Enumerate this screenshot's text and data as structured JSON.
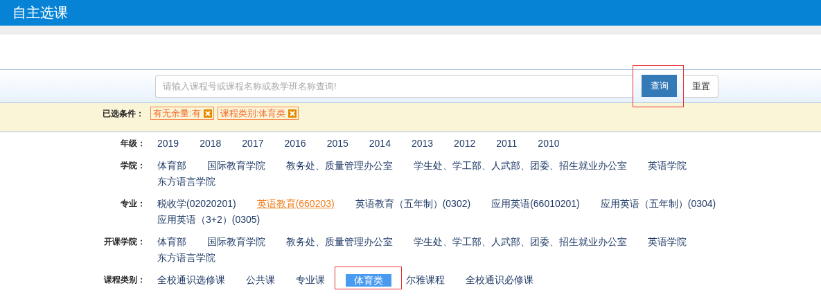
{
  "header": {
    "title": "自主选课"
  },
  "search": {
    "placeholder": "请输入课程号或课程名称或教学班名称查询!",
    "buttons": [
      {
        "label": "查询",
        "kind": "primary",
        "highlighted": true
      },
      {
        "label": "重置",
        "kind": "plain",
        "highlighted": false
      }
    ]
  },
  "selected_conditions": {
    "label": "已选条件：",
    "chips": [
      {
        "label": "有无余量:有"
      },
      {
        "label": "课程类别:体育类"
      }
    ]
  },
  "filters": [
    {
      "label": "年级：",
      "kind": "text",
      "options": [
        {
          "label": "2019",
          "selected": false
        },
        {
          "label": "2018",
          "selected": false
        },
        {
          "label": "2017",
          "selected": false
        },
        {
          "label": "2016",
          "selected": false
        },
        {
          "label": "2015",
          "selected": false
        },
        {
          "label": "2014",
          "selected": false
        },
        {
          "label": "2013",
          "selected": false
        },
        {
          "label": "2012",
          "selected": false
        },
        {
          "label": "2011",
          "selected": false
        },
        {
          "label": "2010",
          "selected": false
        }
      ]
    },
    {
      "label": "学院：",
      "kind": "text",
      "options": [
        {
          "label": "体育部",
          "selected": false
        },
        {
          "label": "国际教育学院",
          "selected": false
        },
        {
          "label": "教务处、质量管理办公室",
          "selected": false
        },
        {
          "label": "学生处、学工部、人武部、团委、招生就业办公室",
          "selected": false
        },
        {
          "label": "英语学院",
          "selected": false
        },
        {
          "label": "东方语言学院",
          "selected": false
        }
      ]
    },
    {
      "label": "专业：",
      "kind": "text",
      "options": [
        {
          "label": "税收学(02020201)",
          "selected": false
        },
        {
          "label": "英语教育(660203)",
          "selected": true
        },
        {
          "label": "英语教育（五年制）(0302)",
          "selected": false
        },
        {
          "label": "应用英语(66010201)",
          "selected": false
        },
        {
          "label": "应用英语（五年制）(0304)",
          "selected": false
        },
        {
          "label": "应用英语（3+2）(0305)",
          "selected": false
        }
      ]
    },
    {
      "label": "开课学院：",
      "kind": "text",
      "options": [
        {
          "label": "体育部",
          "selected": false
        },
        {
          "label": "国际教育学院",
          "selected": false
        },
        {
          "label": "教务处、质量管理办公室",
          "selected": false
        },
        {
          "label": "学生处、学工部、人武部、团委、招生就业办公室",
          "selected": false
        },
        {
          "label": "英语学院",
          "selected": false
        },
        {
          "label": "东方语言学院",
          "selected": false
        }
      ]
    },
    {
      "label": "课程类别：",
      "kind": "pill",
      "options": [
        {
          "label": "全校通识选修课",
          "selected": false,
          "highlighted": false
        },
        {
          "label": "公共课",
          "selected": false,
          "highlighted": false
        },
        {
          "label": "专业课",
          "selected": false,
          "highlighted": false
        },
        {
          "label": "体育类",
          "selected": true,
          "highlighted": true
        },
        {
          "label": "尔雅课程",
          "selected": false,
          "highlighted": false
        },
        {
          "label": "全校通识必修课",
          "selected": false,
          "highlighted": false
        }
      ]
    }
  ]
}
